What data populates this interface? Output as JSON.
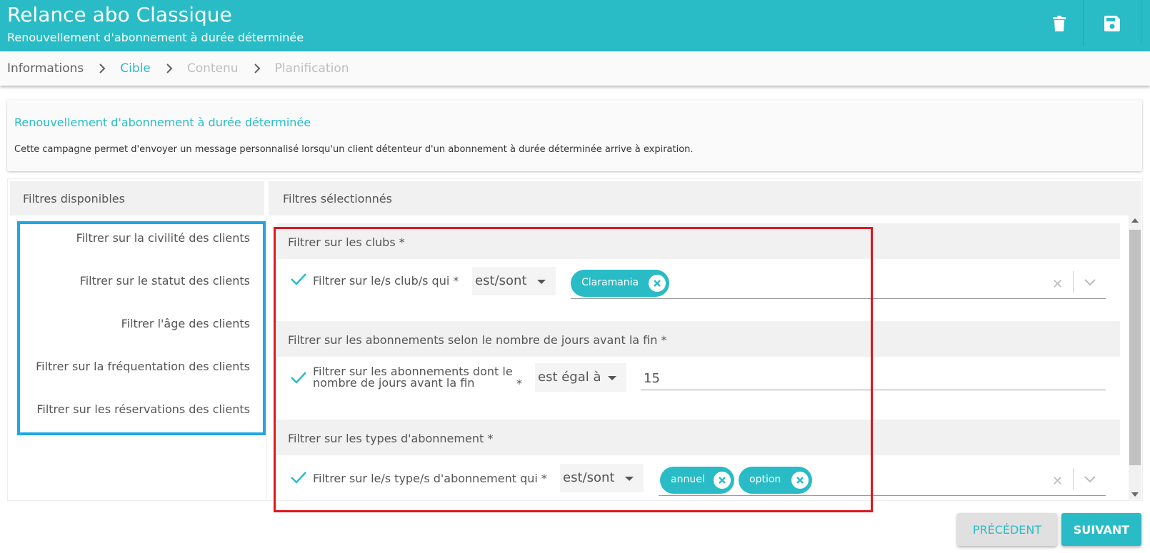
{
  "header": {
    "title": "Relance abo Classique",
    "subtitle": "Renouvellement d'abonnement à durée déterminée",
    "delete_icon": "trash-icon",
    "save_icon": "floppy-disk-icon"
  },
  "stepper": {
    "steps": [
      "Informations",
      "Cible",
      "Contenu",
      "Planification"
    ],
    "active": "Cible"
  },
  "info": {
    "title": "Renouvellement d'abonnement à durée déterminée",
    "description": "Cette campagne permet d'envoyer un message personnalisé lorsqu'un client détenteur d'un abonnement à durée déterminée arrive à expiration."
  },
  "available": {
    "heading": "Filtres disponibles",
    "items": [
      "Filtrer sur la civilité des clients",
      "Filtrer sur le statut des clients",
      "Filtrer l'âge des clients",
      "Filtrer sur la fréquentation des clients",
      "Filtrer sur les réservations des clients"
    ]
  },
  "selected": {
    "heading": "Filtres sélectionnés",
    "groups": [
      {
        "title": "Filtrer sur les clubs *",
        "label": "Filtrer sur le/s club/s qui *",
        "operator": "est/sont",
        "chips": [
          "Claramania"
        ]
      },
      {
        "title": "Filtrer sur les abonnements selon le nombre de jours avant la fin *",
        "label_line1": "Filtrer sur les abonnements dont le",
        "label_line2": "nombre de jours avant la fin",
        "asterisk": "*",
        "operator": "est égal à",
        "value": "15"
      },
      {
        "title": "Filtrer sur les types d'abonnement *",
        "label": "Filtrer sur le/s type/s d'abonnement qui *",
        "operator": "est/sont",
        "chips": [
          "annuel",
          "option"
        ]
      }
    ]
  },
  "footer": {
    "prev_label": "PRÉCÉDENT",
    "next_label": "SUIVANT"
  },
  "colors": {
    "accent": "#29bcc6",
    "highlight_blue": "#1ea7e4",
    "highlight_red": "#e0161e"
  }
}
